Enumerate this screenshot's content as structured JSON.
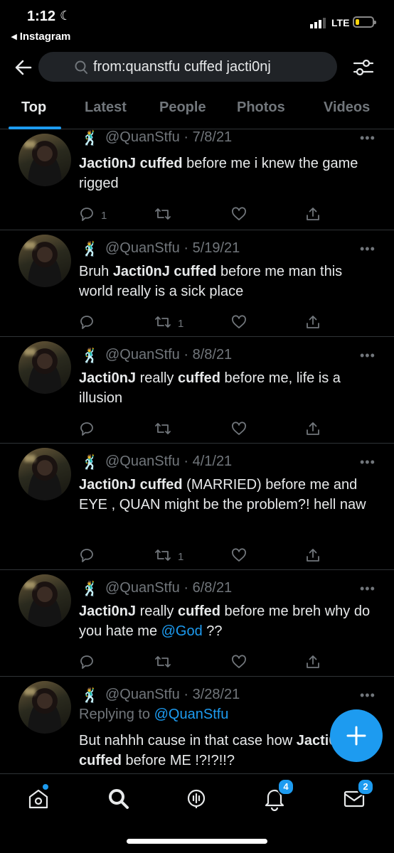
{
  "status_bar": {
    "time": "1:12",
    "back_app": "◂ Instagram",
    "network": "LTE"
  },
  "search": {
    "query": "from:quanstfu cuffed jacti0nj"
  },
  "tabs": [
    "Top",
    "Latest",
    "People",
    "Photos",
    "Videos"
  ],
  "active_tab": "Top",
  "tweets": [
    {
      "handle": "@QuanStfu · 7/8/21",
      "body_html": "<b>Jacti0nJ cuffed</b> before me i knew the game rigged",
      "reply_count": "1",
      "retweet_count": "",
      "like_count": ""
    },
    {
      "handle": "@QuanStfu · 5/19/21",
      "body_html": "Bruh <b>Jacti0nJ cuffed</b> before me man this world really is a sick place",
      "reply_count": "",
      "retweet_count": "1",
      "like_count": ""
    },
    {
      "handle": "@QuanStfu · 8/8/21",
      "body_html": "<b>Jacti0nJ</b> really <b>cuffed</b> before me, life is a illusion",
      "reply_count": "",
      "retweet_count": "",
      "like_count": ""
    },
    {
      "handle": "@QuanStfu · 4/1/21",
      "body_html": "<b>Jacti0nJ cuffed</b> (MARRIED) before me and EYE , QUAN might be the problem?! hell naw",
      "reply_count": "",
      "retweet_count": "1",
      "like_count": ""
    },
    {
      "handle": "@QuanStfu · 6/8/21",
      "body_html": "<b>Jacti0nJ</b> really <b>cuffed</b> before me breh why do you hate me <span class=\"mention\">@God</span> ??",
      "reply_count": "",
      "retweet_count": "",
      "like_count": ""
    },
    {
      "handle": "@QuanStfu · 3/28/21",
      "replying_label": "Replying to",
      "replying_to": "@QuanStfu",
      "body_html": "But nahhh cause in that case how <b>Jacti0nJ</b> <b>cuffed</b> before ME !?!?!!?"
    }
  ],
  "bottom_nav": {
    "notifications_badge": "4",
    "messages_badge": "2"
  },
  "colors": {
    "accent": "#1d9bf0",
    "background": "#000000",
    "muted": "#71767b",
    "divider": "#2f3336"
  },
  "icons": [
    "back-arrow-icon",
    "search-icon",
    "filter-icon",
    "reply-icon",
    "retweet-icon",
    "like-icon",
    "share-icon",
    "more-icon",
    "compose-icon",
    "home-icon",
    "explore-icon",
    "spaces-icon",
    "notifications-icon",
    "messages-icon"
  ]
}
